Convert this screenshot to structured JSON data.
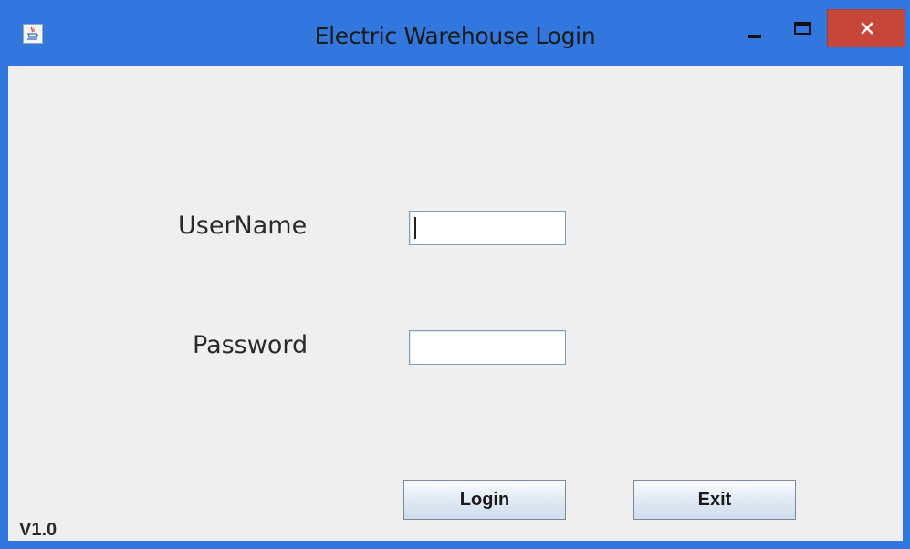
{
  "window": {
    "title": "Electric Warehouse Login",
    "controls": {
      "minimize": "minimize",
      "maximize": "maximize",
      "close": "close"
    }
  },
  "form": {
    "username_label": "UserName",
    "username_value": "",
    "password_label": "Password",
    "password_value": ""
  },
  "buttons": {
    "login_label": "Login",
    "exit_label": "Exit"
  },
  "footer": {
    "version": "V1.0"
  },
  "icons": {
    "app": "java-cup-icon",
    "minimize": "minimize-icon",
    "maximize": "maximize-icon",
    "close": "close-icon"
  },
  "colors": {
    "titlebar": "#3277dd",
    "content_bg": "#efefef",
    "close_button": "#c7463a"
  }
}
